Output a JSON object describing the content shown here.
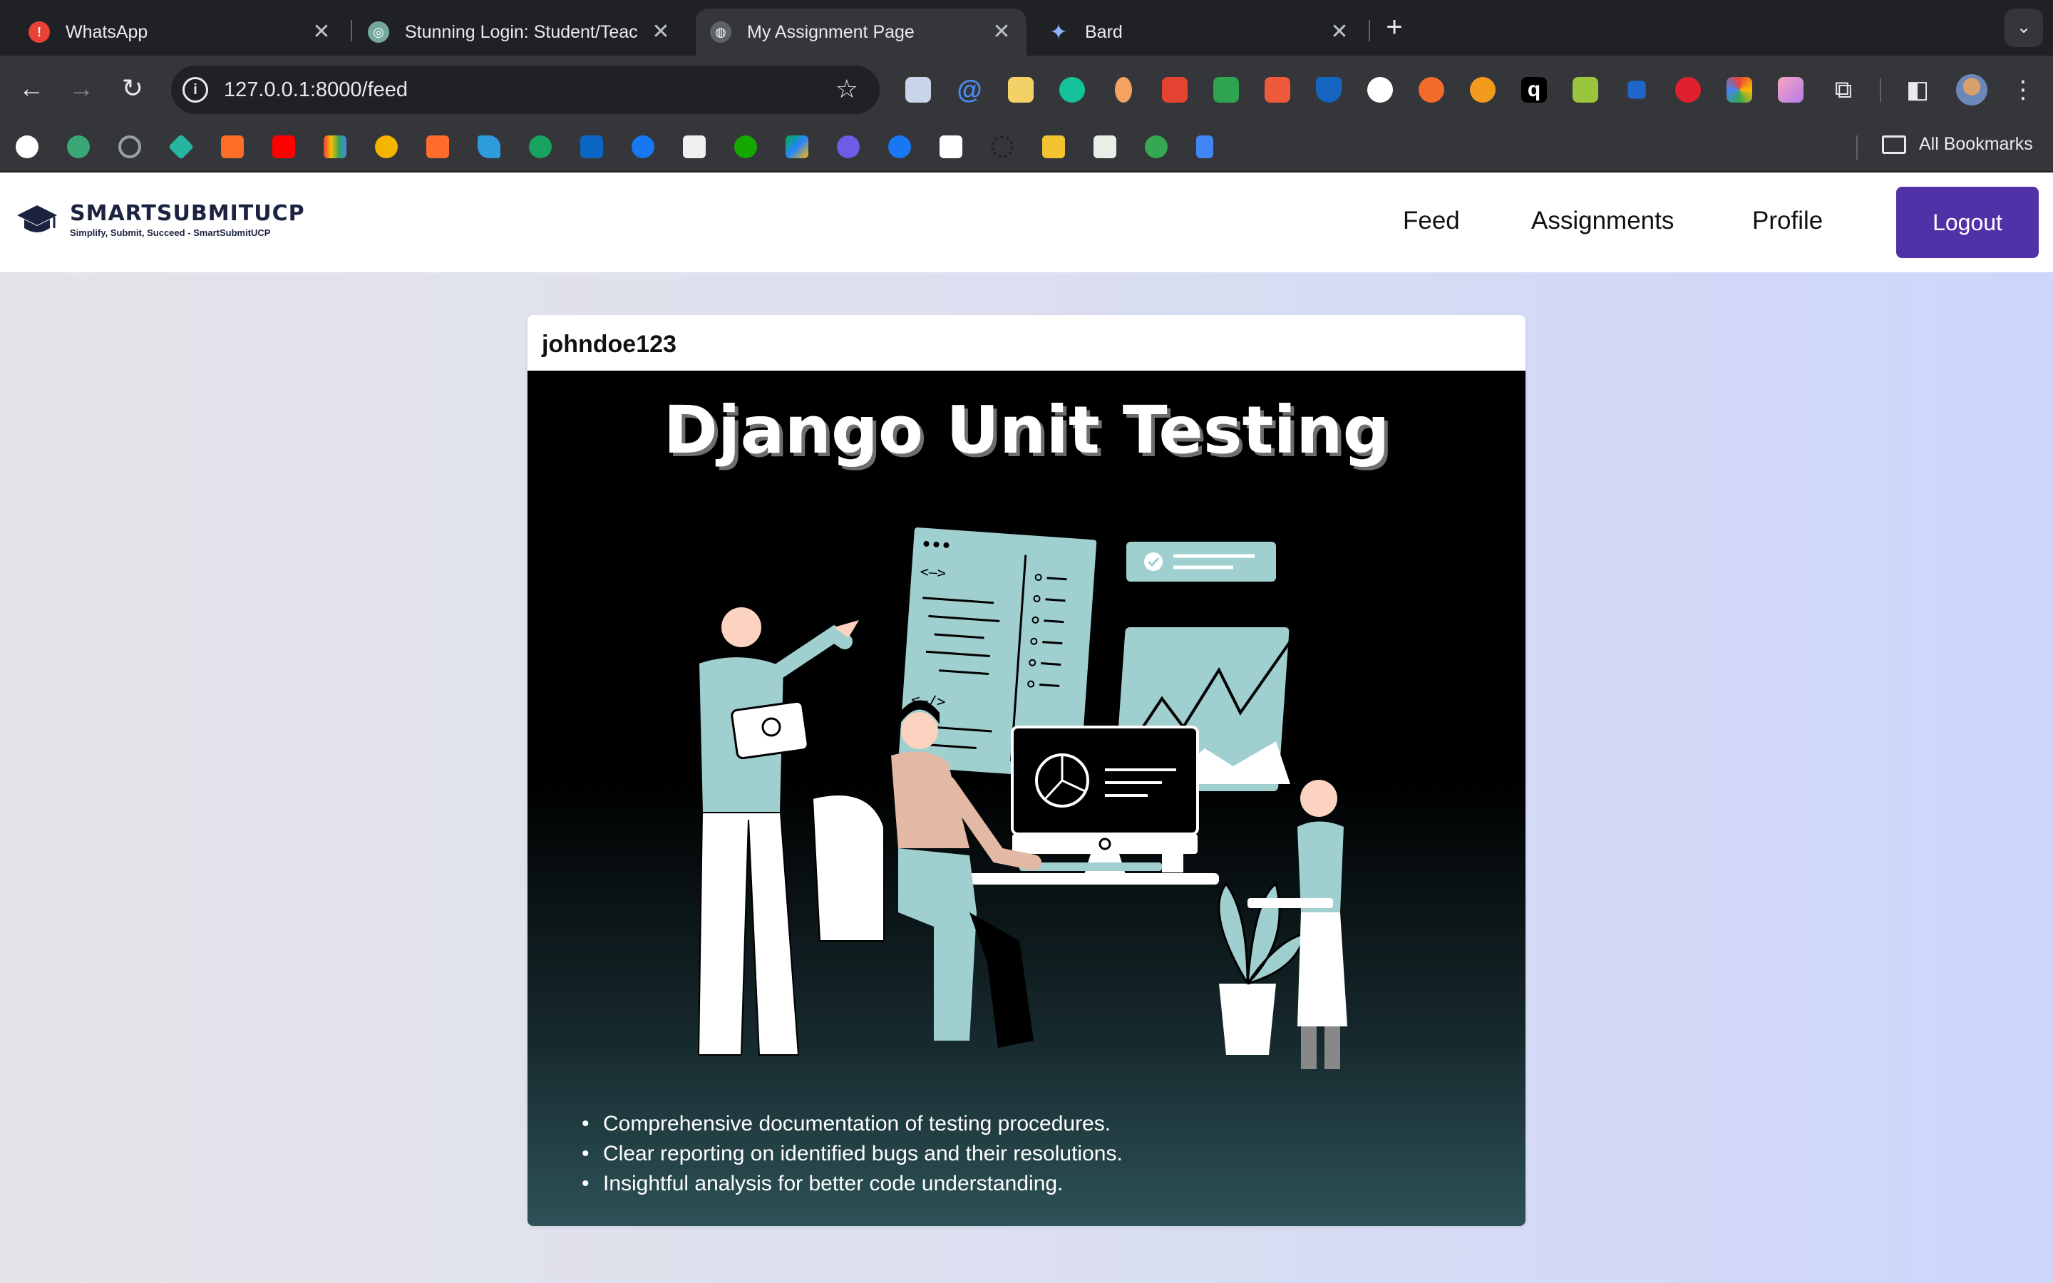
{
  "browser": {
    "tabs": [
      {
        "title": "WhatsApp",
        "active": false,
        "favicon_color": "#ea4335"
      },
      {
        "title": "Stunning Login: Student/Teac",
        "active": false,
        "favicon_color": "#74aa9c"
      },
      {
        "title": "My Assignment Page",
        "active": true,
        "favicon_color": "#9aa0a6"
      },
      {
        "title": "Bard",
        "active": false,
        "favicon_color": "#8ab4f8"
      }
    ],
    "close_glyph": "✕",
    "new_tab_glyph": "+",
    "url": "127.0.0.1:8000/feed",
    "all_bookmarks_label": "All Bookmarks",
    "colors": {
      "tabstrip": "#202124",
      "toolbar": "#35363a"
    }
  },
  "page": {
    "brand": {
      "name": "SMARTSUBMITUCP",
      "tagline": "Simplify, Submit, Succeed - SmartSubmitUCP"
    },
    "nav": {
      "feed": "Feed",
      "assignments": "Assignments",
      "profile": "Profile",
      "logout": "Logout"
    },
    "accent_color": "#5131a8",
    "post": {
      "username": "johndoe123",
      "image_title": "Django Unit Testing",
      "bullets": [
        "Comprehensive documentation of testing procedures.",
        "Clear reporting on identified bugs and their resolutions.",
        "Insightful analysis for better code understanding."
      ]
    }
  }
}
